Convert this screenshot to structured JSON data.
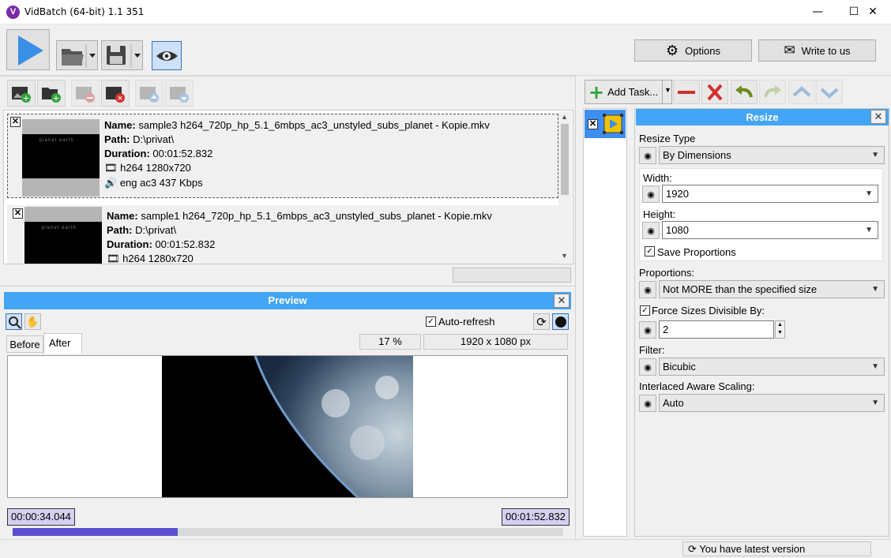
{
  "window": {
    "title": "VidBatch (64-bit) 1.1 351",
    "app_icon_letter": "V",
    "minimize": "—",
    "maximize": "☐",
    "close": "✕"
  },
  "toolbar": {
    "options_label": "Options",
    "write_label": "Write to us"
  },
  "files": [
    {
      "name_label": "Name:",
      "name": "sample3 h264_720p_hp_5.1_6mbps_ac3_unstyled_subs_planet - Kopie.mkv",
      "path_label": "Path:",
      "path": "D:\\privat\\",
      "duration_label": "Duration:",
      "duration": "00:01:52.832",
      "video": "h264 1280x720",
      "audio": "eng ac3 437 Kbps",
      "checked_mark": "✕"
    },
    {
      "name_label": "Name:",
      "name": "sample1 h264_720p_hp_5.1_6mbps_ac3_unstyled_subs_planet - Kopie.mkv",
      "path_label": "Path:",
      "path": "D:\\privat\\",
      "duration_label": "Duration:",
      "duration": "00:01:52.832",
      "video": "h264 1280x720",
      "checked_mark": "✕"
    }
  ],
  "preview": {
    "title": "Preview",
    "auto_refresh_label": "Auto-refresh",
    "auto_refresh_checked": true,
    "tab_before": "Before",
    "tab_after": "After",
    "zoom": "17 %",
    "resolution": "1920 x 1080 px",
    "time_start": "00:00:34.044",
    "time_end": "00:01:52.832",
    "position_fraction": 0.3
  },
  "tasks": {
    "add_task_label": "Add Task...",
    "task_checked_mark": "✕"
  },
  "resize": {
    "title": "Resize",
    "resize_type_label": "Resize Type",
    "resize_type_value": "By Dimensions",
    "width_label": "Width:",
    "width_value": "1920",
    "height_label": "Height:",
    "height_value": "1080",
    "save_proportions_label": "Save Proportions",
    "proportions_label": "Proportions:",
    "proportions_value": "Not MORE than the specified size",
    "force_divisible_label": "Force Sizes Divisible By:",
    "divisible_value": "2",
    "filter_label": "Filter:",
    "filter_value": "Bicubic",
    "interlaced_label": "Interlaced Aware Scaling:",
    "interlaced_value": "Auto"
  },
  "status": {
    "version_text": "You have latest version"
  },
  "colors": {
    "accent": "#42a5f5",
    "play": "#3a8fe6",
    "progress": "#5a4fcf"
  }
}
